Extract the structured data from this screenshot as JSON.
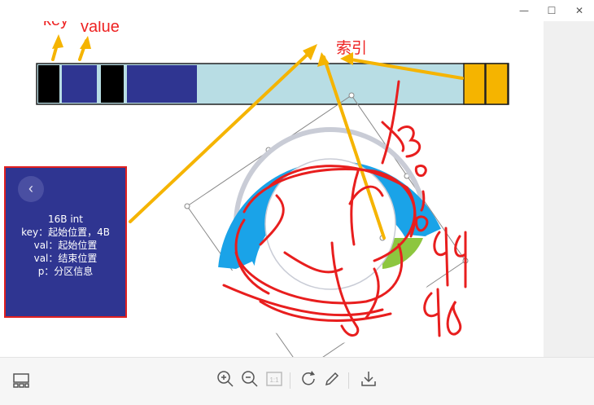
{
  "window": {
    "minimize_label": "—",
    "maximize_label": "☐",
    "close_label": "✕"
  },
  "annotations": {
    "key_label": "key",
    "value_label": "value",
    "index_label": "索引"
  },
  "info_box": {
    "back_icon": "chevron-left-icon",
    "lines": [
      "16B  int",
      "key：起始位置，4B",
      "val：起始位置",
      "val：结束位置",
      "p：分区信息"
    ]
  },
  "handwriting": {
    "numbers": [
      "3.",
      "0.",
      "94",
      "98"
    ]
  },
  "toolbar": {
    "icons": [
      "thumbnails-icon",
      "zoom-in-icon",
      "zoom-out-icon",
      "actual-size-icon",
      "rotate-icon",
      "edit-pen-icon",
      "download-icon"
    ],
    "actual_size_label": "1:1"
  },
  "colors": {
    "accent_red": "#ee2222",
    "arrow_orange": "#f5b400",
    "bar_blue": "#2f3591",
    "ring_blue": "#1aa3e8",
    "ring_green": "#8dc63f",
    "bar_light": "#b8dde4"
  }
}
